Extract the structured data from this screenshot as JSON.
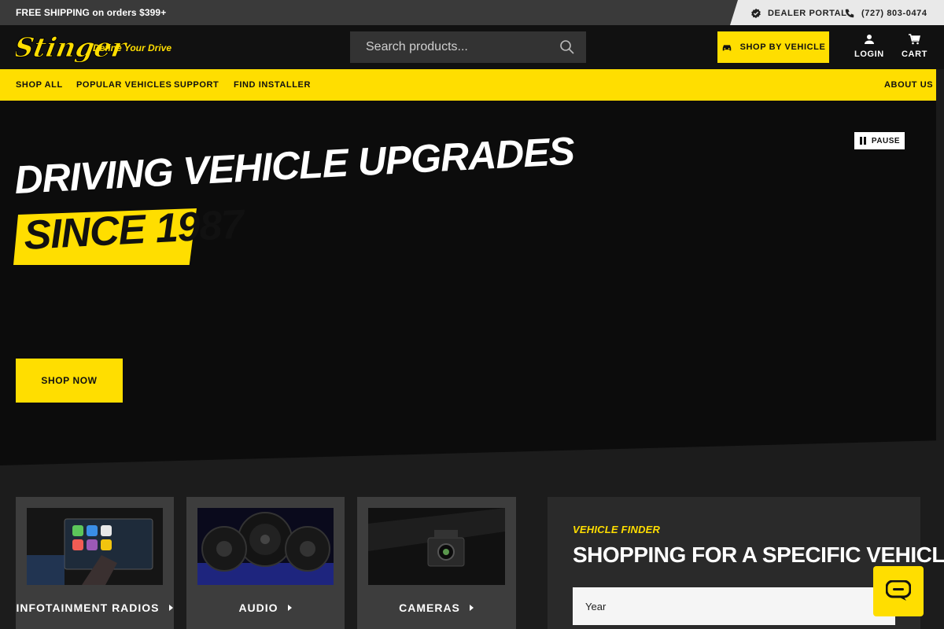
{
  "topbar": {
    "shipping": "FREE SHIPPING on orders $399+",
    "dealer": "DEALER PORTAL",
    "phone": "(727) 803-0474"
  },
  "header": {
    "logo_text": "Stinger",
    "tagline": "Define Your Drive",
    "search_placeholder": "Search products...",
    "shop_by_vehicle": "SHOP BY VEHICLE",
    "login": "LOGIN",
    "cart": "CART"
  },
  "nav": {
    "items": [
      "SHOP ALL",
      "POPULAR VEHICLES",
      "SUPPORT",
      "FIND INSTALLER"
    ],
    "about": "ABOUT US"
  },
  "hero": {
    "pause": "PAUSE",
    "headline": "DRIVING VEHICLE UPGRADES",
    "highlight": "SINCE 1987",
    "cta": "SHOP NOW"
  },
  "categories": [
    {
      "label": "INFOTAINMENT RADIOS",
      "icon": "chevron-right-icon"
    },
    {
      "label": "AUDIO",
      "icon": "chevron-right-icon"
    },
    {
      "label": "CAMERAS",
      "icon": "chevron-right-icon"
    }
  ],
  "finder": {
    "eyebrow": "VEHICLE FINDER",
    "title": "SHOPPING FOR A SPECIFIC VEHICLE?",
    "select_label": "Year"
  },
  "colors": {
    "accent": "#ffde00",
    "dark": "#0c0c0c",
    "panel": "#3d3d3d"
  }
}
